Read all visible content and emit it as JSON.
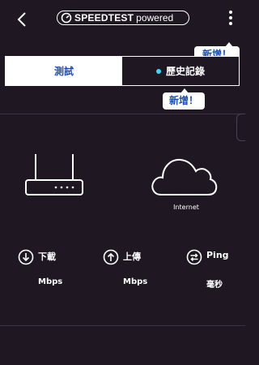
{
  "header": {
    "back_icon": "back-chevron-icon",
    "logo_brand": "SPEEDTEST",
    "logo_suffix": "powered",
    "menu_icon": "more-vertical-icon"
  },
  "tooltips": {
    "menu_new": "新增！",
    "history_new": "新增！"
  },
  "tabs": {
    "test_label": "測試",
    "history_label": "歷史記錄"
  },
  "diagram": {
    "router_icon": "router-icon",
    "cloud_icon": "cloud-icon",
    "internet_label": "Internet"
  },
  "metrics": [
    {
      "icon": "download-icon",
      "label": "下載",
      "unit": "Mbps"
    },
    {
      "icon": "upload-icon",
      "label": "上傳",
      "unit": "Mbps"
    },
    {
      "icon": "ping-icon",
      "label": "Ping",
      "unit": "毫秒"
    }
  ],
  "colors": {
    "background": "#1f1823",
    "accent_blue": "#1a4db5",
    "dot_cyan": "#36d9f0"
  }
}
